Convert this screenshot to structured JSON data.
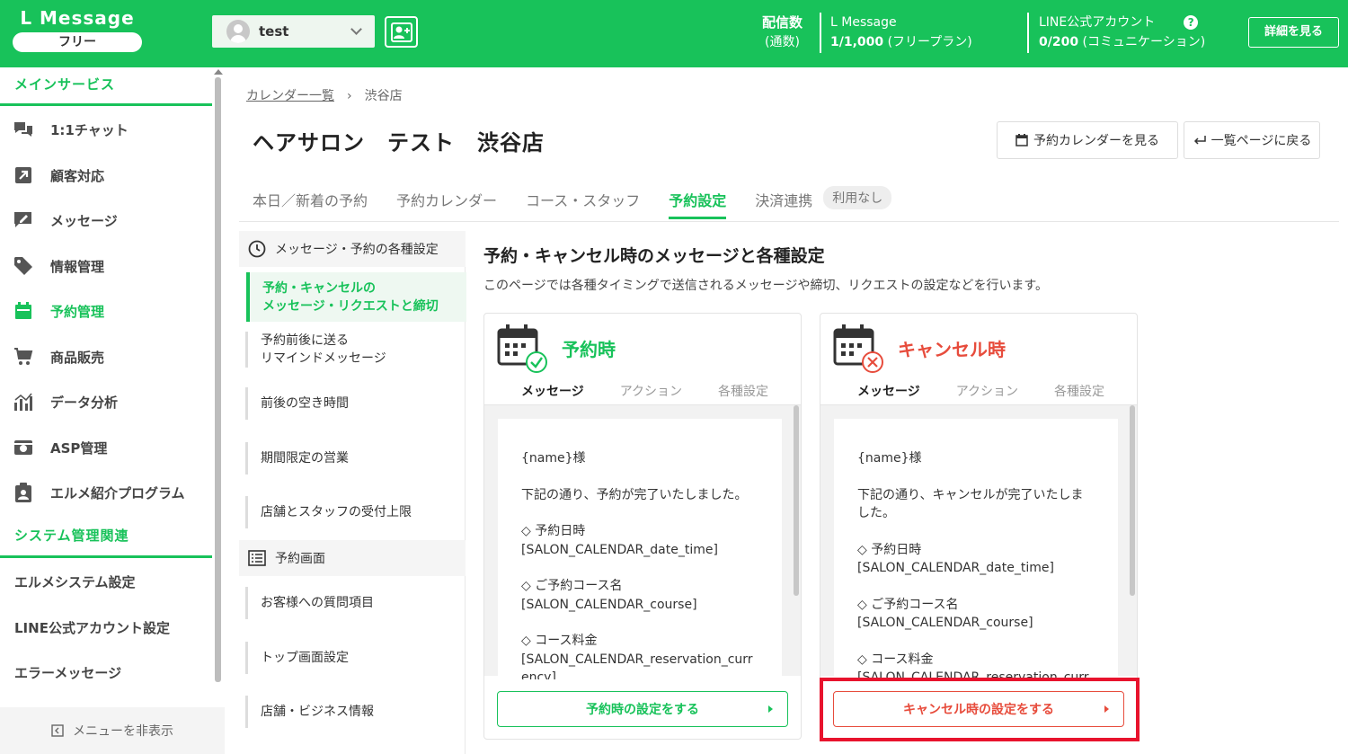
{
  "header": {
    "logo_title": "L Message",
    "logo_plan": "フリー",
    "account_name": "test",
    "stat_delivery_label": "配信数",
    "stat_delivery_sub": "(通数)",
    "stat_lmessage_label": "L Message",
    "stat_lmessage_value": "1/1,000",
    "stat_lmessage_plan": " (フリープラン)",
    "stat_line_label": "LINE公式アカウント",
    "stat_line_value": "0/200",
    "stat_line_plan": " (コミュニケーション)",
    "details_button": "詳細を見る"
  },
  "sidebar": {
    "main_section": "メインサービス",
    "items": [
      {
        "label": "1:1チャット",
        "icon": "chat-icon"
      },
      {
        "label": "顧客対応",
        "icon": "arrow-box-icon"
      },
      {
        "label": "メッセージ",
        "icon": "message-edit-icon"
      },
      {
        "label": "情報管理",
        "icon": "tag-icon"
      },
      {
        "label": "予約管理",
        "icon": "calendar-icon"
      },
      {
        "label": "商品販売",
        "icon": "cart-icon"
      },
      {
        "label": "データ分析",
        "icon": "chart-icon"
      },
      {
        "label": "ASP管理",
        "icon": "asp-icon"
      },
      {
        "label": "エルメ紹介プログラム",
        "icon": "clipboard-user-icon"
      }
    ],
    "system_section": "システム管理関連",
    "system_items": [
      "エルメシステム設定",
      "LINE公式アカウント設定",
      "エラーメッセージ"
    ],
    "hide_menu": "メニューを非表示"
  },
  "breadcrumb": {
    "parent": "カレンダー一覧",
    "current": "渋谷店"
  },
  "page_title": "ヘアサロン　テスト　渋谷店",
  "buttons": {
    "view_calendar": "予約カレンダーを見る",
    "back_to_list": "一覧ページに戻る"
  },
  "tabs": [
    {
      "label": "本日／新着の予約",
      "active": false
    },
    {
      "label": "予約カレンダー",
      "active": false
    },
    {
      "label": "コース・スタッフ",
      "active": false
    },
    {
      "label": "予約設定",
      "active": true
    },
    {
      "label": "決済連携",
      "active": false
    }
  ],
  "tab_badge": "利用なし",
  "subnav": {
    "head1": "メッセージ・予約の各種設定",
    "active_item_line1": "予約・キャンセルの",
    "active_item_line2": "メッセージ・リクエストと締切",
    "item_remind_line1": "予約前後に送る",
    "item_remind_line2": "リマインドメッセージ",
    "item_gap": "前後の空き時間",
    "item_limited": "期間限定の営業",
    "item_capacity": "店舗とスタッフの受付上限",
    "head2": "予約画面",
    "item_questions": "お客様への質問項目",
    "item_top": "トップ画面設定",
    "item_store": "店舗・ビジネス情報"
  },
  "content": {
    "title": "予約・キャンセル時のメッセージと各種設定",
    "description": "このページでは各種タイミングで送信されるメッセージや締切、リクエストの設定などを行います。"
  },
  "cards": {
    "reserve": {
      "title": "予約時",
      "tab_message": "メッセージ",
      "tab_action": "アクション",
      "tab_settings": "各種設定",
      "line_name": "{name}様",
      "line_done": "下記の通り、予約が完了いたしました。",
      "line_date_label": "◇ 予約日時",
      "line_date_var": "[SALON_CALENDAR_date_time]",
      "line_course_label": "◇ ご予約コース名",
      "line_course_var": "[SALON_CALENDAR_course]",
      "line_fee_label": "◇ コース料金",
      "line_fee_var": "[SALON_CALENDAR_reservation_currency]",
      "button": "予約時の設定をする",
      "color": "#18c25a"
    },
    "cancel": {
      "title": "キャンセル時",
      "tab_message": "メッセージ",
      "tab_action": "アクション",
      "tab_settings": "各種設定",
      "line_name": "{name}様",
      "line_done": "下記の通り、キャンセルが完了いたしました。",
      "line_date_label": "◇ 予約日時",
      "line_date_var": "[SALON_CALENDAR_date_time]",
      "line_course_label": "◇ ご予約コース名",
      "line_course_var": "[SALON_CALENDAR_course]",
      "line_fee_label": "◇ コース料金",
      "line_fee_var": "[SALON_CALENDAR_reservation_currency]",
      "button": "キャンセル時の設定をする",
      "color": "#e74c3c"
    }
  },
  "colors": {
    "brand": "#18c25a",
    "cancel": "#e74c3c",
    "highlight": "#e8132d"
  }
}
